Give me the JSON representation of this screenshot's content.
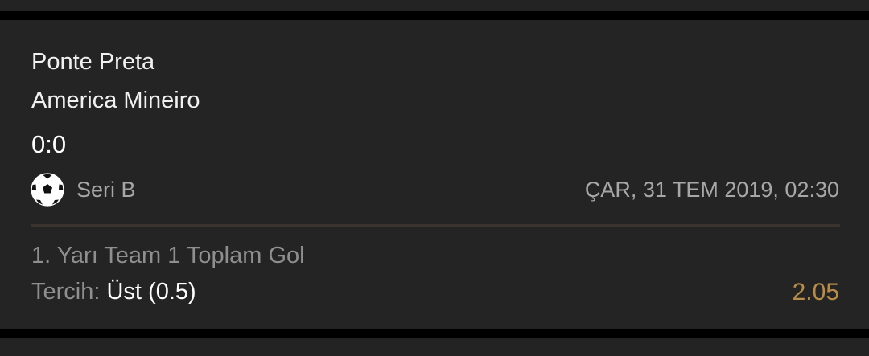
{
  "match": {
    "team1": "Ponte Preta",
    "team2": "America Mineiro",
    "score": "0:0",
    "sport_icon": "soccer-ball-icon",
    "league": "Seri B",
    "datetime": "ÇAR, 31 TEM 2019, 02:30"
  },
  "bet": {
    "market": "1. Yarı Team 1 Toplam Gol",
    "pick_label": "Tercih:",
    "pick_value": "Üst (0.5)",
    "odds": "2.05"
  },
  "colors": {
    "background": "#242424",
    "odds": "#b88d4a",
    "muted_text": "#8f8f8f"
  }
}
